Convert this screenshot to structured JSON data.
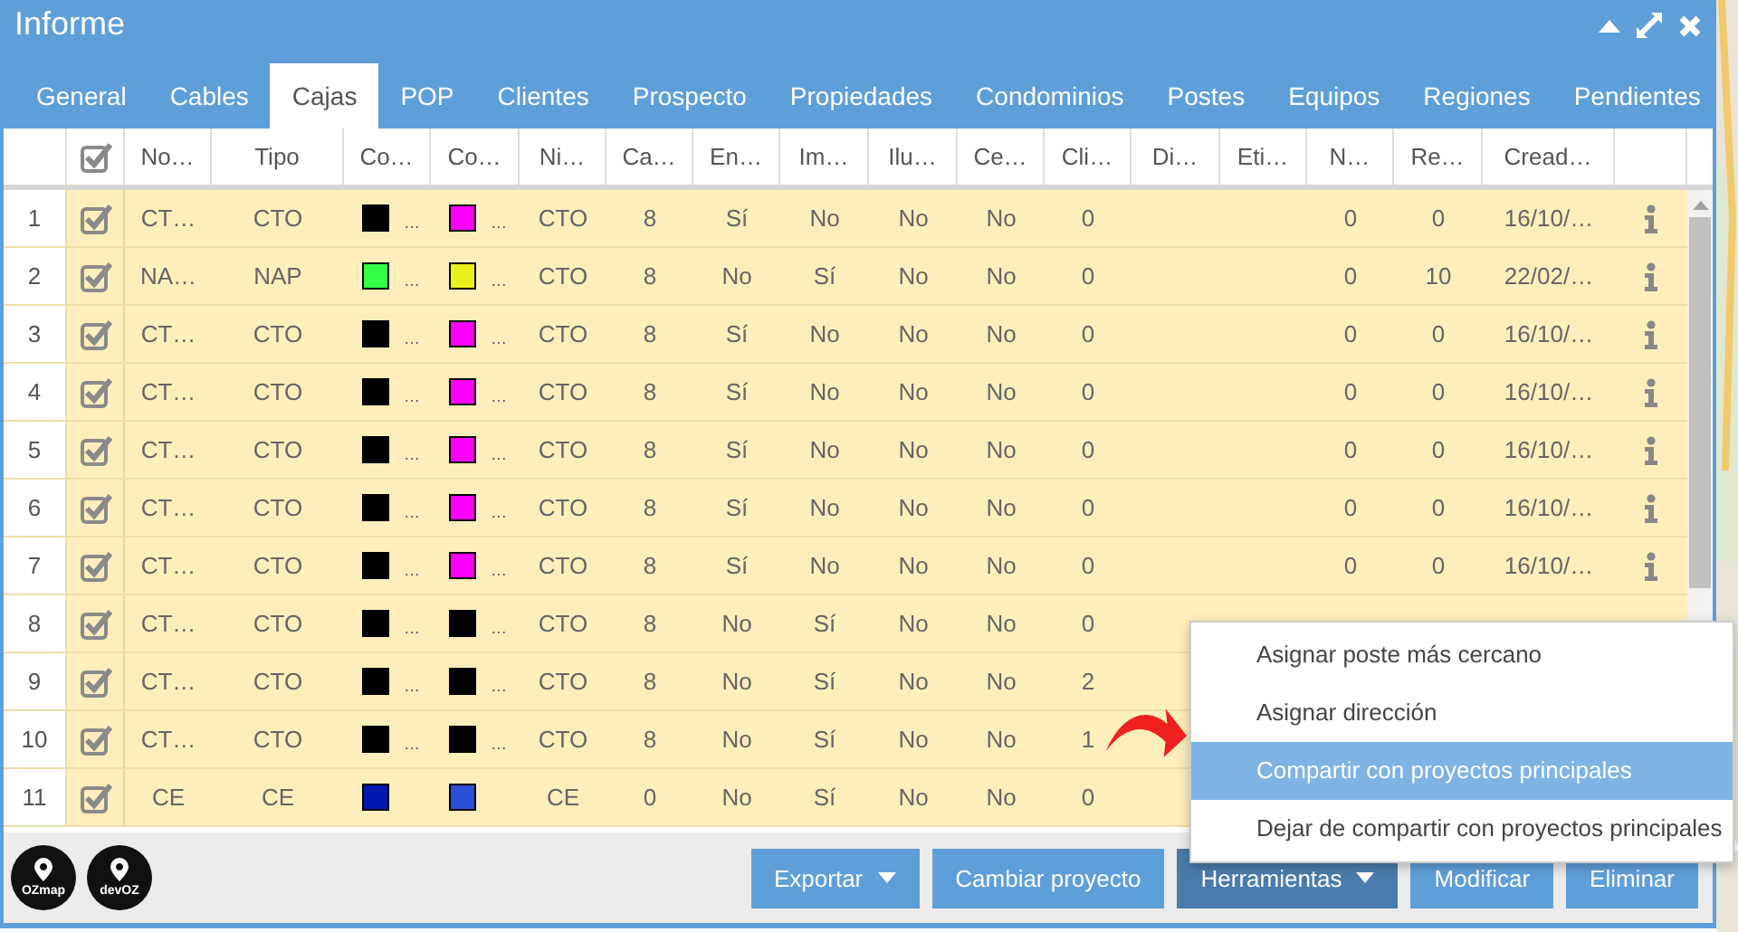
{
  "window": {
    "title": "Informe"
  },
  "tabs": [
    {
      "label": "General",
      "selected": false
    },
    {
      "label": "Cables",
      "selected": false
    },
    {
      "label": "Cajas",
      "selected": true
    },
    {
      "label": "POP",
      "selected": false
    },
    {
      "label": "Clientes",
      "selected": false
    },
    {
      "label": "Prospecto",
      "selected": false
    },
    {
      "label": "Propiedades",
      "selected": false
    },
    {
      "label": "Condominios",
      "selected": false
    },
    {
      "label": "Postes",
      "selected": false
    },
    {
      "label": "Equipos",
      "selected": false
    },
    {
      "label": "Regiones",
      "selected": false
    },
    {
      "label": "Pendientes",
      "selected": false
    }
  ],
  "table": {
    "select_all": {
      "checked": true
    },
    "columns": [
      "No…",
      "Tipo",
      "Co…",
      "Co…",
      "Ni…",
      "Ca…",
      "En…",
      "Im…",
      "Ilu…",
      "Ce…",
      "Cli…",
      "Di…",
      "Eti…",
      "N…",
      "Re…",
      "Cread…"
    ],
    "rows": [
      {
        "number": "1",
        "checked": true,
        "cells": [
          "CT…",
          "CTO",
          {
            "color": "#000000",
            "text": "…"
          },
          {
            "color": "#ff00ff",
            "text": "…"
          },
          "CTO",
          "8",
          "Sí",
          "No",
          "No",
          "No",
          "0",
          "",
          "",
          "0",
          "0",
          "16/10/…"
        ]
      },
      {
        "number": "2",
        "checked": true,
        "cells": [
          "NA…",
          "NAP",
          {
            "color": "#33ff44",
            "text": "…"
          },
          {
            "color": "#e8f21a",
            "text": "…"
          },
          "CTO",
          "8",
          "No",
          "Sí",
          "No",
          "No",
          "0",
          "",
          "",
          "0",
          "10",
          "22/02/…"
        ]
      },
      {
        "number": "3",
        "checked": true,
        "cells": [
          "CT…",
          "CTO",
          {
            "color": "#000000",
            "text": "…"
          },
          {
            "color": "#ff00ff",
            "text": "…"
          },
          "CTO",
          "8",
          "Sí",
          "No",
          "No",
          "No",
          "0",
          "",
          "",
          "0",
          "0",
          "16/10/…"
        ]
      },
      {
        "number": "4",
        "checked": true,
        "cells": [
          "CT…",
          "CTO",
          {
            "color": "#000000",
            "text": "…"
          },
          {
            "color": "#ff00ff",
            "text": "…"
          },
          "CTO",
          "8",
          "Sí",
          "No",
          "No",
          "No",
          "0",
          "",
          "",
          "0",
          "0",
          "16/10/…"
        ]
      },
      {
        "number": "5",
        "checked": true,
        "cells": [
          "CT…",
          "CTO",
          {
            "color": "#000000",
            "text": "…"
          },
          {
            "color": "#ff00ff",
            "text": "…"
          },
          "CTO",
          "8",
          "Sí",
          "No",
          "No",
          "No",
          "0",
          "",
          "",
          "0",
          "0",
          "16/10/…"
        ]
      },
      {
        "number": "6",
        "checked": true,
        "cells": [
          "CT…",
          "CTO",
          {
            "color": "#000000",
            "text": "…"
          },
          {
            "color": "#ff00ff",
            "text": "…"
          },
          "CTO",
          "8",
          "Sí",
          "No",
          "No",
          "No",
          "0",
          "",
          "",
          "0",
          "0",
          "16/10/…"
        ]
      },
      {
        "number": "7",
        "checked": true,
        "cells": [
          "CT…",
          "CTO",
          {
            "color": "#000000",
            "text": "…"
          },
          {
            "color": "#ff00ff",
            "text": "…"
          },
          "CTO",
          "8",
          "Sí",
          "No",
          "No",
          "No",
          "0",
          "",
          "",
          "0",
          "0",
          "16/10/…"
        ]
      },
      {
        "number": "8",
        "checked": true,
        "cells": [
          "CT…",
          "CTO",
          {
            "color": "#000000",
            "text": "…"
          },
          {
            "color": "#000000",
            "text": "…"
          },
          "CTO",
          "8",
          "No",
          "Sí",
          "No",
          "No",
          "0"
        ]
      },
      {
        "number": "9",
        "checked": true,
        "cells": [
          "CT…",
          "CTO",
          {
            "color": "#000000",
            "text": "…"
          },
          {
            "color": "#000000",
            "text": "…"
          },
          "CTO",
          "8",
          "No",
          "Sí",
          "No",
          "No",
          "2"
        ]
      },
      {
        "number": "10",
        "checked": true,
        "cells": [
          "CT…",
          "CTO",
          {
            "color": "#000000",
            "text": "…"
          },
          {
            "color": "#000000",
            "text": "…"
          },
          "CTO",
          "8",
          "No",
          "Sí",
          "No",
          "No",
          "1"
        ]
      },
      {
        "number": "11",
        "checked": true,
        "cells": [
          "CE",
          "CE",
          {
            "color": "#0018b0",
            "text": ""
          },
          {
            "color": "#2c4fd8",
            "text": ""
          },
          "CE",
          "0",
          "No",
          "Sí",
          "No",
          "No",
          "0"
        ]
      }
    ]
  },
  "logos": [
    {
      "label": "OZmap"
    },
    {
      "label": "devOZ"
    }
  ],
  "buttons": [
    {
      "label": "Exportar",
      "dropdown": true,
      "selected": false
    },
    {
      "label": "Cambiar proyecto",
      "dropdown": false,
      "selected": false
    },
    {
      "label": "Herramientas",
      "dropdown": true,
      "selected": true
    },
    {
      "label": "Modificar",
      "dropdown": false,
      "selected": false
    },
    {
      "label": "Eliminar",
      "dropdown": false,
      "selected": false
    }
  ],
  "menu": {
    "items": [
      {
        "label": "Asignar poste más cercano",
        "selected": false
      },
      {
        "label": "Asignar dirección",
        "selected": false
      },
      {
        "label": "Compartir con proyectos principales",
        "selected": true
      },
      {
        "label": "Dejar de compartir con proyectos principales",
        "selected": false
      }
    ]
  }
}
